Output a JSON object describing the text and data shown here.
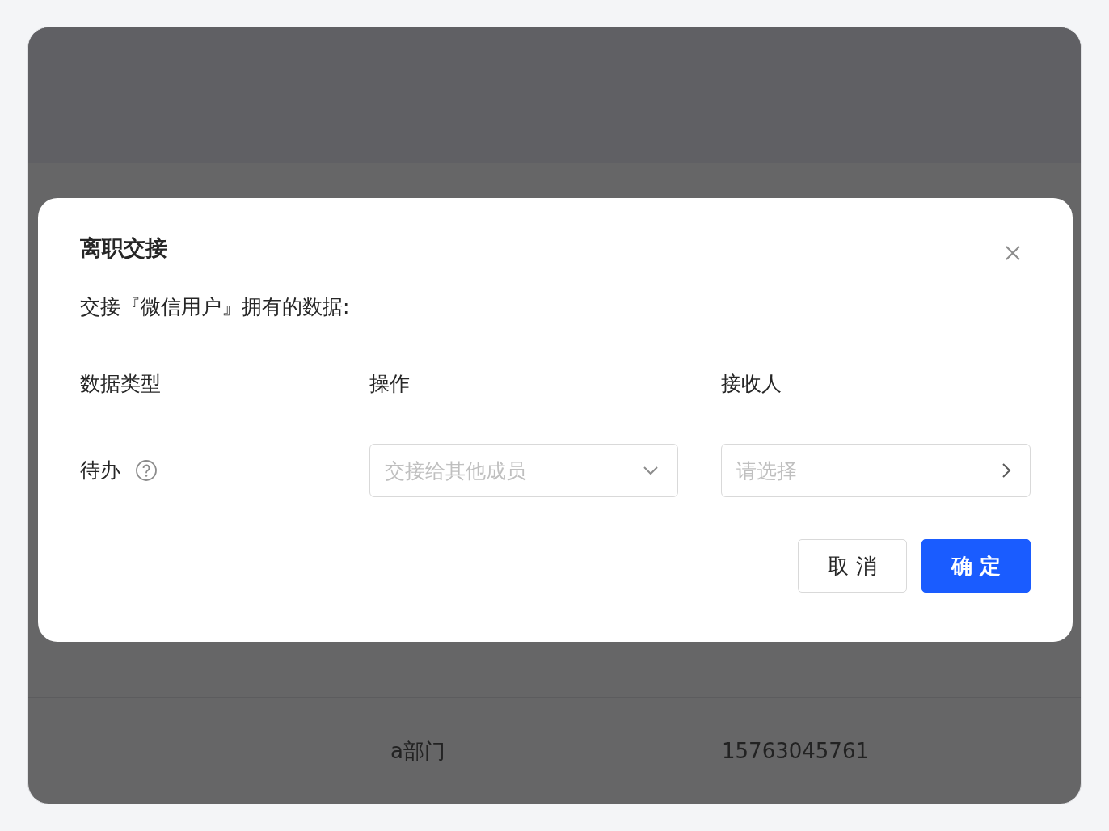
{
  "background_table": {
    "rows": [
      {
        "department": "a部门",
        "phone": "15763045761"
      }
    ]
  },
  "dialog": {
    "title": "离职交接",
    "subtitle": "交接『微信用户』拥有的数据:",
    "columns": [
      "数据类型",
      "操作",
      "接收人"
    ],
    "rows": [
      {
        "data_type": "待办",
        "action": {
          "placeholder": "交接给其他成员"
        },
        "receiver": {
          "placeholder": "请选择"
        }
      }
    ],
    "buttons": [
      {
        "label": "取 消",
        "kind": "secondary"
      },
      {
        "label": "确 定",
        "kind": "primary"
      }
    ]
  }
}
